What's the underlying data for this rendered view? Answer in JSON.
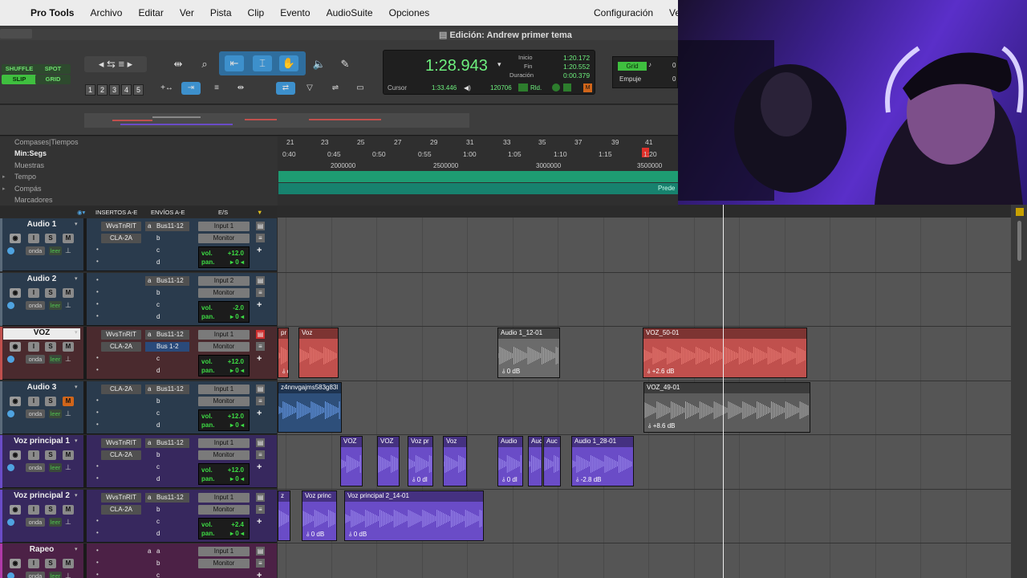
{
  "menubar": {
    "app": "Pro Tools",
    "items": [
      "Archivo",
      "Editar",
      "Ver",
      "Pista",
      "Clip",
      "Evento",
      "AudioSuite",
      "Opciones"
    ],
    "right_items": [
      "Configuración",
      "Ven"
    ]
  },
  "window": {
    "title": "Edición: Andrew primer tema"
  },
  "edit_modes": {
    "shuffle": "SHUFFLE",
    "spot": "SPOT",
    "slip": "SLIP",
    "grid": "GRID"
  },
  "zoom_presets": [
    "1",
    "2",
    "3",
    "4",
    "5"
  ],
  "counter": {
    "main": "1:28.943",
    "start_label": "Inicio",
    "start": "1:20.172",
    "end_label": "Fin",
    "end": "1:20.552",
    "length_label": "Duración",
    "length": "0:00.379",
    "cursor_label": "Cursor",
    "cursor": "1:33.446",
    "samples": "120706",
    "rld": "Rld."
  },
  "grid": {
    "grid_label": "Grid",
    "nudge_label": "Empuje",
    "grid_value": "0",
    "nudge_value": "0"
  },
  "rulers": {
    "names": [
      "Compases|Tiempos",
      "Min:Segs",
      "Muestras",
      "Tempo",
      "Compás",
      "Marcadores"
    ],
    "bars": [
      "21",
      "23",
      "25",
      "27",
      "29",
      "31",
      "33",
      "35",
      "37",
      "39",
      "41"
    ],
    "minsecs": [
      "0:40",
      "0:45",
      "0:50",
      "0:55",
      "1:00",
      "1:05",
      "1:10",
      "1:15",
      "1:20"
    ],
    "samples": [
      "2000000",
      "2500000",
      "3000000",
      "3500000"
    ],
    "meter_tag": "Prede"
  },
  "column_headers": {
    "inserts": "INSERTOS A-E",
    "sends": "ENVÍOS A-E",
    "io": "E/S"
  },
  "tracks": [
    {
      "name": "Audio 1",
      "ins": [
        "WvsTnRIT",
        "CLA-2A"
      ],
      "send": "Bus11-12",
      "send_b": "b",
      "in": "Input 1",
      "out": "Monitor",
      "vol": "+12.0",
      "pan": "0",
      "read": "leer",
      "wave": "onda"
    },
    {
      "name": "Audio 2",
      "ins": [
        "",
        ""
      ],
      "send": "Bus11-12",
      "send_b": "b",
      "in": "Input 2",
      "out": "Monitor",
      "vol": "-2.0",
      "pan": "0",
      "read": "leer",
      "wave": "onda"
    },
    {
      "name": "VOZ",
      "ins": [
        "WvsTnRIT",
        "CLA-2A"
      ],
      "send": "Bus11-12",
      "send_b": "Bus 1-2",
      "in": "Input 1",
      "out": "Monitor",
      "vol": "+12.0",
      "pan": "0",
      "read": "leer",
      "wave": "onda"
    },
    {
      "name": "Audio 3",
      "ins": [
        "CLA-2A",
        ""
      ],
      "send": "Bus11-12",
      "send_b": "b",
      "in": "Input 1",
      "out": "Monitor",
      "vol": "+12.0",
      "pan": "0",
      "read": "leer",
      "wave": "onda"
    },
    {
      "name": "Voz principal 1",
      "ins": [
        "WvsTnRIT",
        "CLA-2A"
      ],
      "send": "Bus11-12",
      "send_b": "b",
      "in": "Input 1",
      "out": "Monitor",
      "vol": "+12.0",
      "pan": "0",
      "read": "leer",
      "wave": "onda"
    },
    {
      "name": "Voz principal 2",
      "ins": [
        "WvsTnRIT",
        "CLA-2A"
      ],
      "send": "Bus11-12",
      "send_b": "b",
      "in": "Input 1",
      "out": "Monitor",
      "vol": "+2.4",
      "pan": "0",
      "read": "leer",
      "wave": "onda"
    },
    {
      "name": "Rapeo",
      "ins": [
        "",
        ""
      ],
      "send": "a",
      "send_b": "b",
      "in": "Input 1",
      "out": "Monitor",
      "vol": "",
      "pan": "",
      "read": "leer",
      "wave": "onda"
    }
  ],
  "labels": {
    "vol": "vol.",
    "pan": "pan.",
    "sends": [
      "a",
      "b",
      "c",
      "d"
    ]
  },
  "clips": [
    {
      "name": "Audio 1_12-01",
      "gain": "0 dB"
    },
    {
      "name": "VOZ_50-01",
      "gain": "+2.6 dB"
    },
    {
      "name": "pr",
      "gain": "dl"
    },
    {
      "name": "Voz",
      "gain": ""
    },
    {
      "name": "z4nnvgajms583g83l",
      "gain": ""
    },
    {
      "name": "VOZ_49-01",
      "gain": "+8.6 dB"
    },
    {
      "name": "VOZ",
      "gain": ""
    },
    {
      "name": "VOZ",
      "gain": ""
    },
    {
      "name": "Voz pr",
      "gain": "0 dl"
    },
    {
      "name": "Voz",
      "gain": ""
    },
    {
      "name": "Audio",
      "gain": "0 dl"
    },
    {
      "name": "Auc",
      "gain": ""
    },
    {
      "name": "Auc",
      "gain": ""
    },
    {
      "name": "Audio 1_28-01",
      "gain": "-2.8 dB"
    },
    {
      "name": "Voz princ",
      "gain": "0 dB"
    },
    {
      "name": "Voz principal 2_14-01",
      "gain": "0 dB"
    },
    {
      "name": "z",
      "gain": ""
    }
  ],
  "colors": {
    "voz": "#c0504d",
    "audio3": "#4a7fd1",
    "vozprincipal": "#6a4cc7",
    "rapeo": "#b03aa8",
    "audio": "#6f6f6f"
  }
}
